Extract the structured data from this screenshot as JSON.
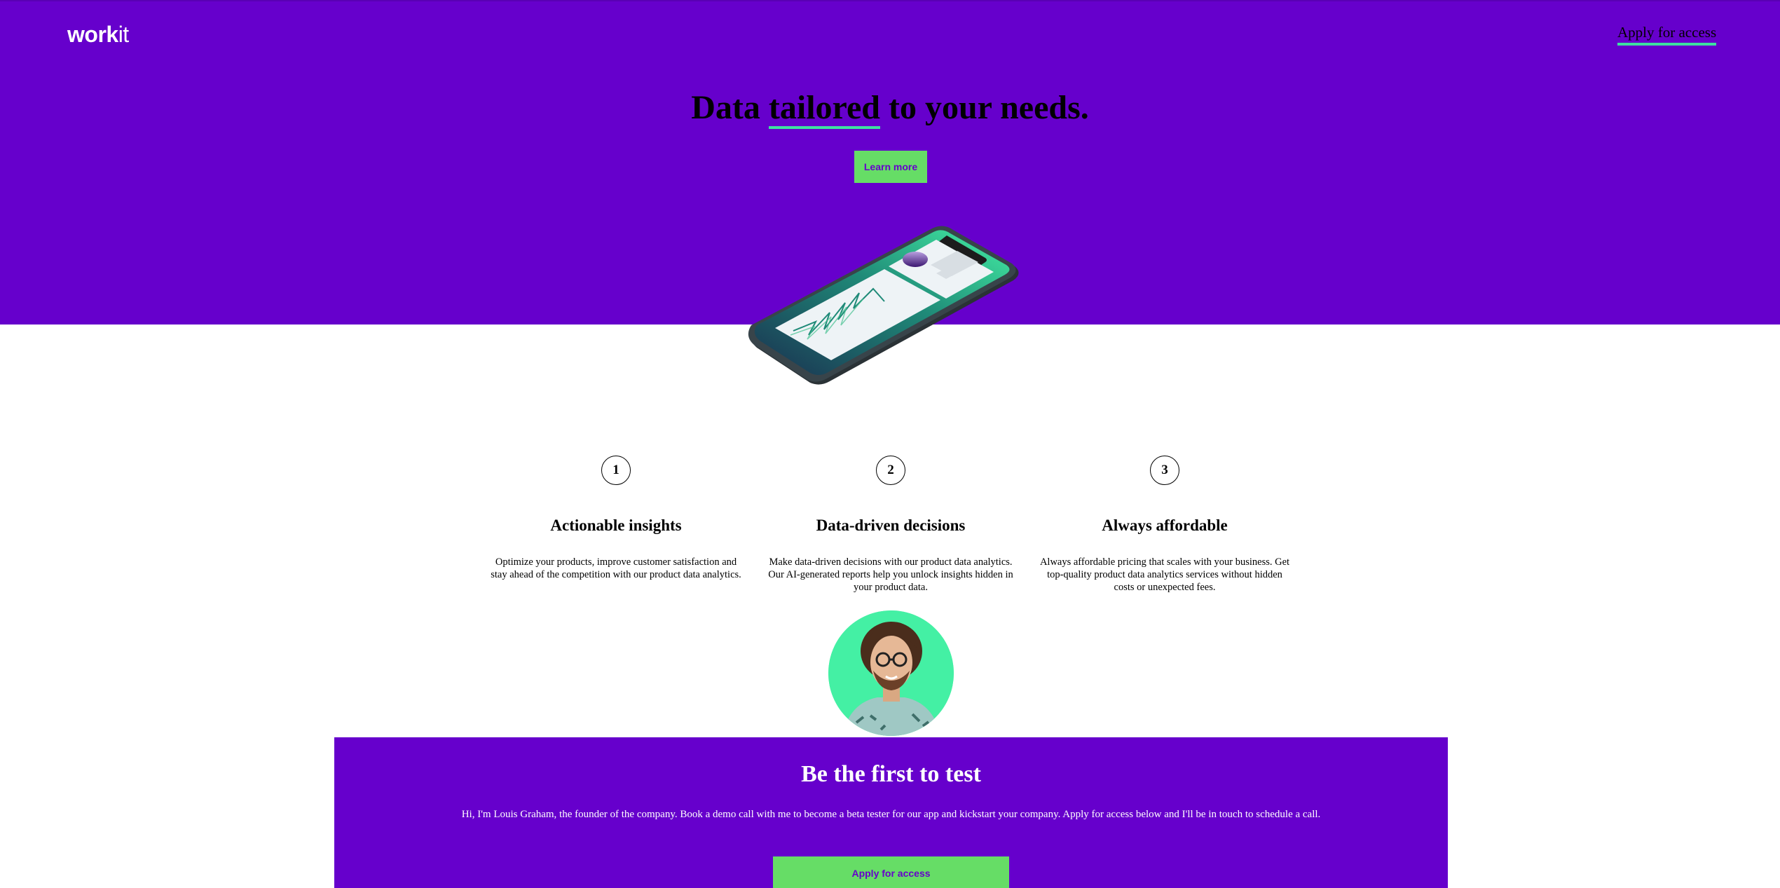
{
  "header": {
    "logo_bold": "work",
    "logo_light": "it",
    "nav_apply_label": "Apply for access"
  },
  "hero": {
    "headline_before": "Data ",
    "headline_underlined": "tailored",
    "headline_after": " to your needs.",
    "learn_more_label": "Learn more",
    "phone_image": "phone-analytics-illustration"
  },
  "features": [
    {
      "number": "1",
      "title": "Actionable insights",
      "description": "Optimize your products, improve customer satisfaction and stay ahead of the competition with our product data analytics."
    },
    {
      "number": "2",
      "title": "Data-driven decisions",
      "description": "Make data-driven decisions with our product data analytics. Our AI-generated reports help you unlock insights hidden in your product data."
    },
    {
      "number": "3",
      "title": "Always affordable",
      "description": "Always affordable pricing that scales with your business. Get top-quality product data analytics services without hidden costs or unexpected fees."
    }
  ],
  "cta": {
    "avatar_image": "founder-avatar",
    "title": "Be the first to test",
    "text": "Hi, I'm Louis Graham, the founder of the company. Book a demo call with me to become a beta tester for our app and kickstart your company. Apply for access below and I'll be in touch to schedule a call.",
    "apply_label": "Apply for access"
  },
  "colors": {
    "brand_purple": "#6600cc",
    "accent_green": "#66dd66",
    "accent_mint": "#3ee0a0"
  }
}
